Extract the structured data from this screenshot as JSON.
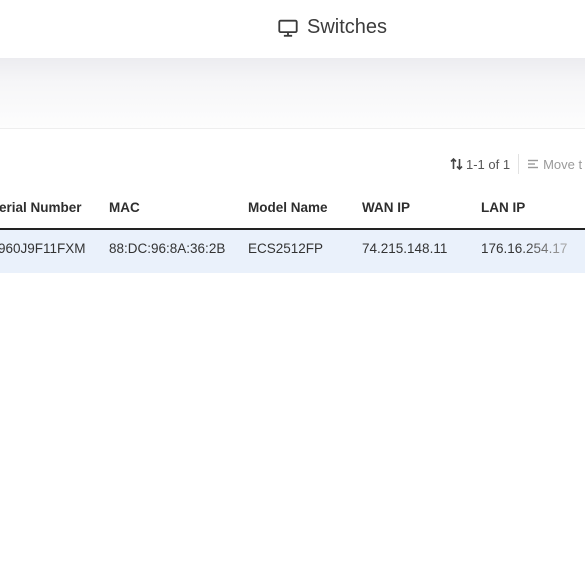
{
  "header": {
    "title": "Switches",
    "icon": "monitor-icon"
  },
  "toolbar": {
    "pagination": "1-1 of 1",
    "move_label": "Move t"
  },
  "table": {
    "columns": [
      "erial Number",
      "MAC",
      "Model Name",
      "WAN IP",
      "LAN IP"
    ],
    "rows": [
      [
        "960J9F11FXM",
        "88:DC:96:8A:36:2B",
        "ECS2512FP",
        "74.215.148.11",
        "176.16.254.17"
      ]
    ]
  },
  "colors": {
    "selected_row": "#eaf1fb",
    "header_rule": "#222222"
  }
}
